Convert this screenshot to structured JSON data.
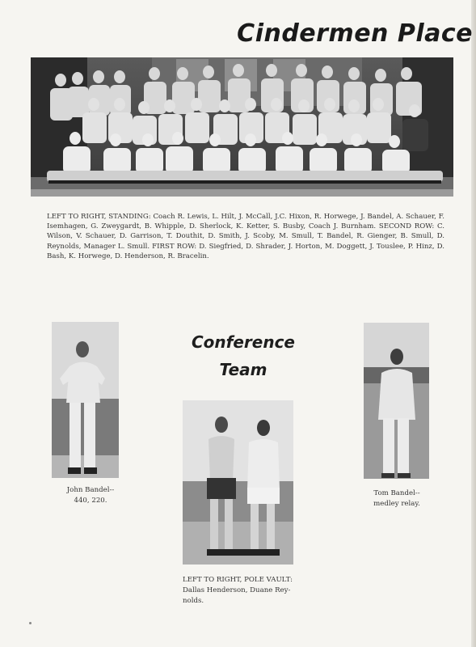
{
  "page": {
    "title": "Cindermen Place",
    "section_heading_line1": "Conference",
    "section_heading_line2": "Team"
  },
  "team_photo": {
    "caption": "LEFT TO RIGHT, STANDING: Coach R. Lewis, L. Hilt, J. McCall, J.C. Hixon, R. Horwege, J. Bandel, A. Schauer, F. Isemhagen, G. Zweygardt, B. Whipple, D. Sherlock, K. Ketter, S. Busby, Coach J. Burnham. SECOND ROW: C. Wilson, V. Schauer, D. Garrison, T. Douthit, D. Smith, J. Scoby, M. Smull, T. Bandel, R. Gienger, B. Smull, D. Reynolds, Manager L. Smull. FIRST ROW: D. Siegfried, D. Shrader, J. Horton, M. Doggett, J. Touslee, P. Hinz, D. Bash, K. Horwege, D. Henderson, R. Bracelin."
  },
  "photos": {
    "john": {
      "caption_line1": "John Bandel--",
      "caption_line2": "440, 220."
    },
    "tom": {
      "caption_line1": "Tom Bandel--",
      "caption_line2": "medley relay."
    },
    "pole_vault": {
      "caption_line1": "LEFT TO RIGHT, POLE VAULT:",
      "caption_line2": "Dallas Henderson, Duane Rey-",
      "caption_line3": "nolds."
    }
  }
}
